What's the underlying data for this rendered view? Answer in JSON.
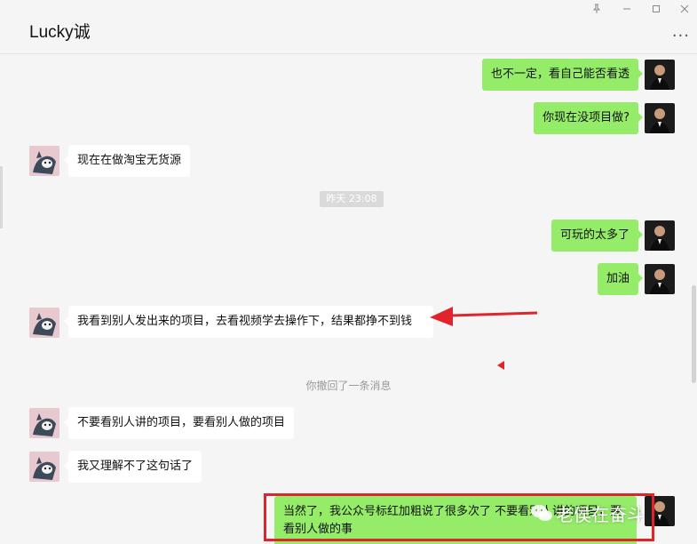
{
  "header": {
    "title": "Lucky诚",
    "pin_icon": "pin-icon",
    "minimize_icon": "minimize-icon",
    "maximize_icon": "maximize-icon",
    "close_icon": "close-icon",
    "more_icon": "more-icon"
  },
  "messages": [
    {
      "side": "me",
      "text": "也不一定，看自己能否看透"
    },
    {
      "side": "me",
      "text": "你现在没项目做?"
    },
    {
      "side": "other",
      "text": "现在在做淘宝无货源"
    },
    {
      "side": "me",
      "text": "可玩的太多了"
    },
    {
      "side": "me",
      "text": "加油"
    },
    {
      "side": "other",
      "text": "我看到别人发出来的项目，去看视频学去操作下，结果都挣不到钱"
    },
    {
      "side": "other",
      "text": "不要看别人讲的项目，要看别人做的项目"
    },
    {
      "side": "other",
      "text": "我又理解不了这句话了"
    },
    {
      "side": "me",
      "text": "当然了，我公众号标红加粗说了很多次了  不要看别人讲的项目，要看别人做的事"
    }
  ],
  "timestamp": "昨天 23:08",
  "system_notice": "你撤回了一条消息",
  "watermark": "老侯在奋斗",
  "colors": {
    "me_bubble": "#95ec69",
    "other_bubble": "#ffffff",
    "annotation_red": "#e0242c",
    "background": "#f5f5f5"
  }
}
